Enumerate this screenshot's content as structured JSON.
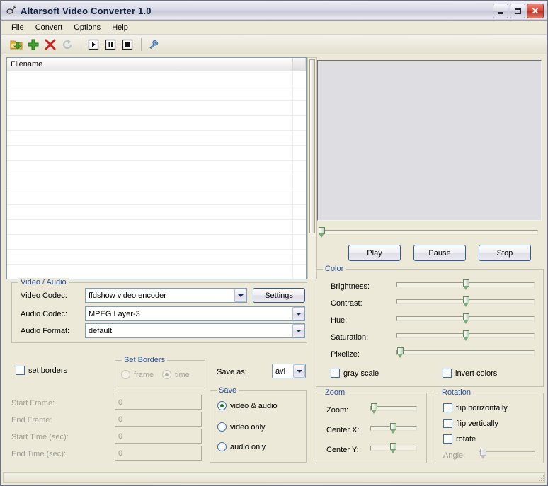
{
  "window": {
    "title": "Altarsoft Video Converter 1.0",
    "icon": "app-icon",
    "buttons": {
      "minimize": "minimize-button",
      "maximize": "maximize-button",
      "close": "close-button"
    }
  },
  "menubar": {
    "items": [
      "File",
      "Convert",
      "Options",
      "Help"
    ]
  },
  "toolbar": {
    "items": [
      {
        "name": "open-folder-icon",
        "tip": "Open"
      },
      {
        "name": "add-file-icon",
        "tip": "Add"
      },
      {
        "name": "remove-file-icon",
        "tip": "Remove"
      },
      {
        "name": "refresh-icon",
        "tip": "Refresh"
      },
      {
        "name": "play-icon",
        "tip": "Play"
      },
      {
        "name": "pause-icon",
        "tip": "Pause"
      },
      {
        "name": "stop-icon",
        "tip": "Stop"
      },
      {
        "name": "settings-wrench-icon",
        "tip": "Settings"
      }
    ]
  },
  "file_list": {
    "columns": [
      "Filename",
      ""
    ],
    "rows": [],
    "empty_row_count": 14
  },
  "preview": {
    "seek_value": 0,
    "buttons": {
      "play": "Play",
      "pause": "Pause",
      "stop": "Stop"
    }
  },
  "video_audio": {
    "title": "Video / Audio",
    "video_codec_label": "Video Codec:",
    "video_codec_value": "ffdshow video encoder",
    "settings_button": "Settings",
    "audio_codec_label": "Audio Codec:",
    "audio_codec_value": "MPEG Layer-3",
    "audio_format_label": "Audio Format:",
    "audio_format_value": "default"
  },
  "borders": {
    "set_borders_label": "set borders",
    "set_borders_checked": false,
    "group_title": "Set Borders",
    "frame_label": "frame",
    "time_label": "time",
    "selected": "time",
    "disabled": true,
    "save_as_label": "Save as:",
    "save_as_value": "avi"
  },
  "frames": {
    "fields": [
      {
        "label": "Start Frame:",
        "value": "0",
        "disabled": true
      },
      {
        "label": "End Frame:",
        "value": "0",
        "disabled": true
      },
      {
        "label": "Start Time (sec):",
        "value": "0",
        "disabled": true
      },
      {
        "label": "End Time (sec):",
        "value": "0",
        "disabled": true
      }
    ]
  },
  "save": {
    "title": "Save",
    "options": [
      {
        "label": "video & audio",
        "selected": true
      },
      {
        "label": "video only",
        "selected": false
      },
      {
        "label": "audio only",
        "selected": false
      }
    ]
  },
  "color": {
    "title": "Color",
    "sliders": [
      {
        "label": "Brightness:",
        "value": 50
      },
      {
        "label": "Contrast:",
        "value": 50
      },
      {
        "label": "Hue:",
        "value": 50
      },
      {
        "label": "Saturation:",
        "value": 50
      },
      {
        "label": "Pixelize:",
        "value": 1
      }
    ],
    "gray_scale_label": "gray scale",
    "gray_scale_checked": false,
    "invert_colors_label": "invert colors",
    "invert_colors_checked": false
  },
  "zoom": {
    "title": "Zoom",
    "sliders": [
      {
        "label": "Zoom:",
        "value": 2
      },
      {
        "label": "Center X:",
        "value": 50
      },
      {
        "label": "Center Y:",
        "value": 50
      }
    ]
  },
  "rotation": {
    "title": "Rotation",
    "checkboxes": [
      {
        "label": "flip horizontally",
        "checked": false,
        "disabled": false
      },
      {
        "label": "flip vertically",
        "checked": false,
        "disabled": false
      },
      {
        "label": "rotate",
        "checked": false,
        "disabled": false
      }
    ],
    "angle_label": "Angle:",
    "angle_value": 2,
    "angle_disabled": true
  },
  "statusbar": {
    "text": ""
  },
  "colors": {
    "window_face": "#ece9d8",
    "group_title": "#2b52a0",
    "button_border": "#2f5d99",
    "checkbox_border": "#3a6ea5",
    "slider_thumb": "#5d8a58",
    "close_button": "#bd3022",
    "disabled_text": "#9d9d92"
  }
}
